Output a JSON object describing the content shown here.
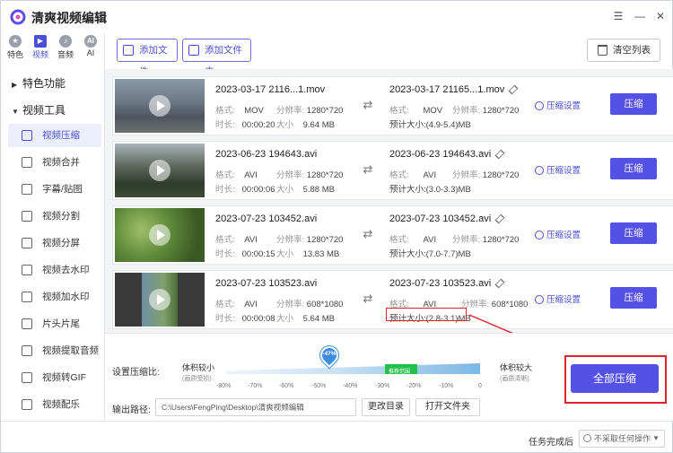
{
  "app": {
    "title": "清爽视频编辑"
  },
  "window_controls": {
    "menu": "☰",
    "minimize": "—",
    "close": "✕"
  },
  "categories": [
    {
      "label": "特色",
      "icon": "star-icon",
      "glyph": "★"
    },
    {
      "label": "视频",
      "icon": "film-icon",
      "glyph": "▶"
    },
    {
      "label": "音频",
      "icon": "music-icon",
      "glyph": "♪"
    },
    {
      "label": "AI",
      "icon": "ai-icon",
      "glyph": "AI"
    }
  ],
  "sidebar": {
    "section_feature": "特色功能",
    "section_video": "视频工具",
    "items": [
      {
        "label": "视频压缩",
        "icon": "compress-icon",
        "active": true
      },
      {
        "label": "视频合并",
        "icon": "merge-icon"
      },
      {
        "label": "字幕/贴图",
        "icon": "subtitle-icon"
      },
      {
        "label": "视频分割",
        "icon": "split-icon"
      },
      {
        "label": "视频分屏",
        "icon": "splitscreen-icon"
      },
      {
        "label": "视频去水印",
        "icon": "remove-watermark-icon"
      },
      {
        "label": "视频加水印",
        "icon": "add-watermark-icon"
      },
      {
        "label": "片头片尾",
        "icon": "intro-outro-icon"
      },
      {
        "label": "视频提取音频",
        "icon": "extract-audio-icon"
      },
      {
        "label": "视频转GIF",
        "icon": "gif-icon"
      },
      {
        "label": "视频配乐",
        "icon": "bgm-icon"
      }
    ]
  },
  "toolbar": {
    "add_file": "添加文件",
    "add_folder": "添加文件夹",
    "clear_list": "清空列表"
  },
  "labels": {
    "format": "格式:",
    "resolution": "分辨率:",
    "duration": "时长:",
    "size": "大小",
    "estimate": "预计大小:",
    "compress_settings": "压缩设置",
    "compress": "压缩"
  },
  "files": [
    {
      "name": "2023-03-17 2116...1.mov",
      "out_name": "2023-03-17 21165...1.mov",
      "format": "MOV",
      "resolution": "1280*720",
      "duration": "00:00:20",
      "size": "9.64 MB",
      "out_format": "MOV",
      "out_resolution": "1280*720",
      "estimate": "(4.9-5.4)MB"
    },
    {
      "name": "2023-06-23 194643.avi",
      "out_name": "2023-06-23 194643.avi",
      "format": "AVI",
      "resolution": "1280*720",
      "duration": "00:00:06",
      "size": "5.88 MB",
      "out_format": "AVI",
      "out_resolution": "1280*720",
      "estimate": "(3.0-3.3)MB"
    },
    {
      "name": "2023-07-23 103452.avi",
      "out_name": "2023-07-23 103452.avi",
      "format": "AVI",
      "resolution": "1280*720",
      "duration": "00:00:15",
      "size": "13.83 MB",
      "out_format": "AVI",
      "out_resolution": "1280*720",
      "estimate": "(7.0-7.7)MB"
    },
    {
      "name": "2023-07-23 103523.avi",
      "out_name": "2023-07-23 103523.avi",
      "format": "AVI",
      "resolution": "608*1080",
      "duration": "00:00:08",
      "size": "5.64 MB",
      "out_format": "AVI",
      "out_resolution": "608*1080",
      "estimate": "(2.8-3.1)MB"
    }
  ],
  "compression": {
    "label": "设置压缩比:",
    "left_label": "体积较小",
    "left_sub": "(画质受损)",
    "right_label": "体积较大",
    "right_sub": "(画质清晰)",
    "value": "-47%",
    "value_percent": -47,
    "recommended": "推荐范围",
    "ticks": [
      "-80%",
      "-70%",
      "-60%",
      "-50%",
      "-40%",
      "-30%",
      "-20%",
      "-10%",
      "0"
    ]
  },
  "output": {
    "label": "输出路径:",
    "path": "C:\\Users\\FengPing\\Desktop\\清爽视频编辑",
    "change_dir": "更改目录",
    "open_folder": "打开文件夹"
  },
  "compress_all": "全部压缩",
  "status": {
    "label": "任务完成后",
    "option": "不采取任何操作"
  },
  "colors": {
    "accent": "#5451e6",
    "highlight": "#e0202a",
    "recommended": "#25c04a"
  }
}
